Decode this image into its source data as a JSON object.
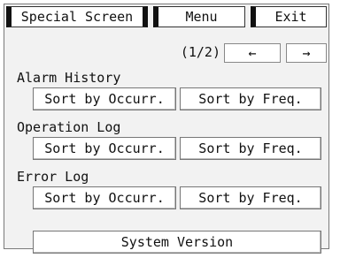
{
  "header": {
    "title_tab": "Special Screen",
    "menu_label": "Menu",
    "exit_label": "Exit"
  },
  "pagination": {
    "indicator": "(1/2)",
    "prev_label": "←",
    "next_label": "→"
  },
  "sections": [
    {
      "label": "Alarm History",
      "btn_occurr": "Sort by Occurr.",
      "btn_freq": "Sort by Freq."
    },
    {
      "label": "Operation Log",
      "btn_occurr": "Sort by Occurr.",
      "btn_freq": "Sort by Freq."
    },
    {
      "label": "Error Log",
      "btn_occurr": "Sort by Occurr.",
      "btn_freq": "Sort by Freq."
    }
  ],
  "footer": {
    "system_version_label": "System Version"
  }
}
